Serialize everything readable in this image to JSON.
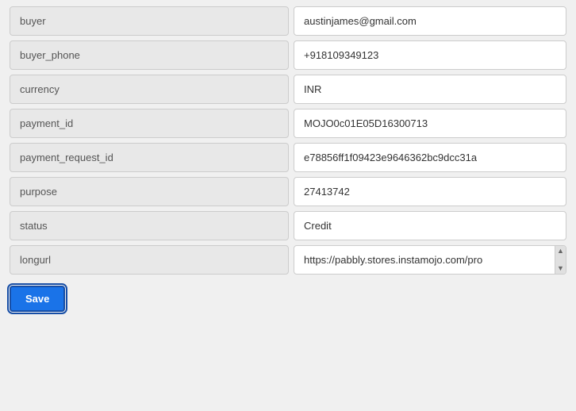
{
  "fields": [
    {
      "id": "buyer",
      "label": "buyer",
      "value": "austinjames@gmail.com",
      "hasScrollbar": false
    },
    {
      "id": "buyer_phone",
      "label": "buyer_phone",
      "value": "+918109349123",
      "hasScrollbar": false
    },
    {
      "id": "currency",
      "label": "currency",
      "value": "INR",
      "hasScrollbar": false
    },
    {
      "id": "payment_id",
      "label": "payment_id",
      "value": "MOJO0c01E05D16300713",
      "hasScrollbar": false
    },
    {
      "id": "payment_request_id",
      "label": "payment_request_id",
      "value": "e78856ff1f09423e9646362bc9dcc31a",
      "hasScrollbar": false
    },
    {
      "id": "purpose",
      "label": "purpose",
      "value": "27413742",
      "hasScrollbar": false
    },
    {
      "id": "status",
      "label": "status",
      "value": "Credit",
      "hasScrollbar": false
    },
    {
      "id": "longurl",
      "label": "longurl",
      "value": "https://pabbly.stores.instamojo.com/pro",
      "hasScrollbar": true
    }
  ],
  "footer": {
    "save_label": "Save"
  }
}
